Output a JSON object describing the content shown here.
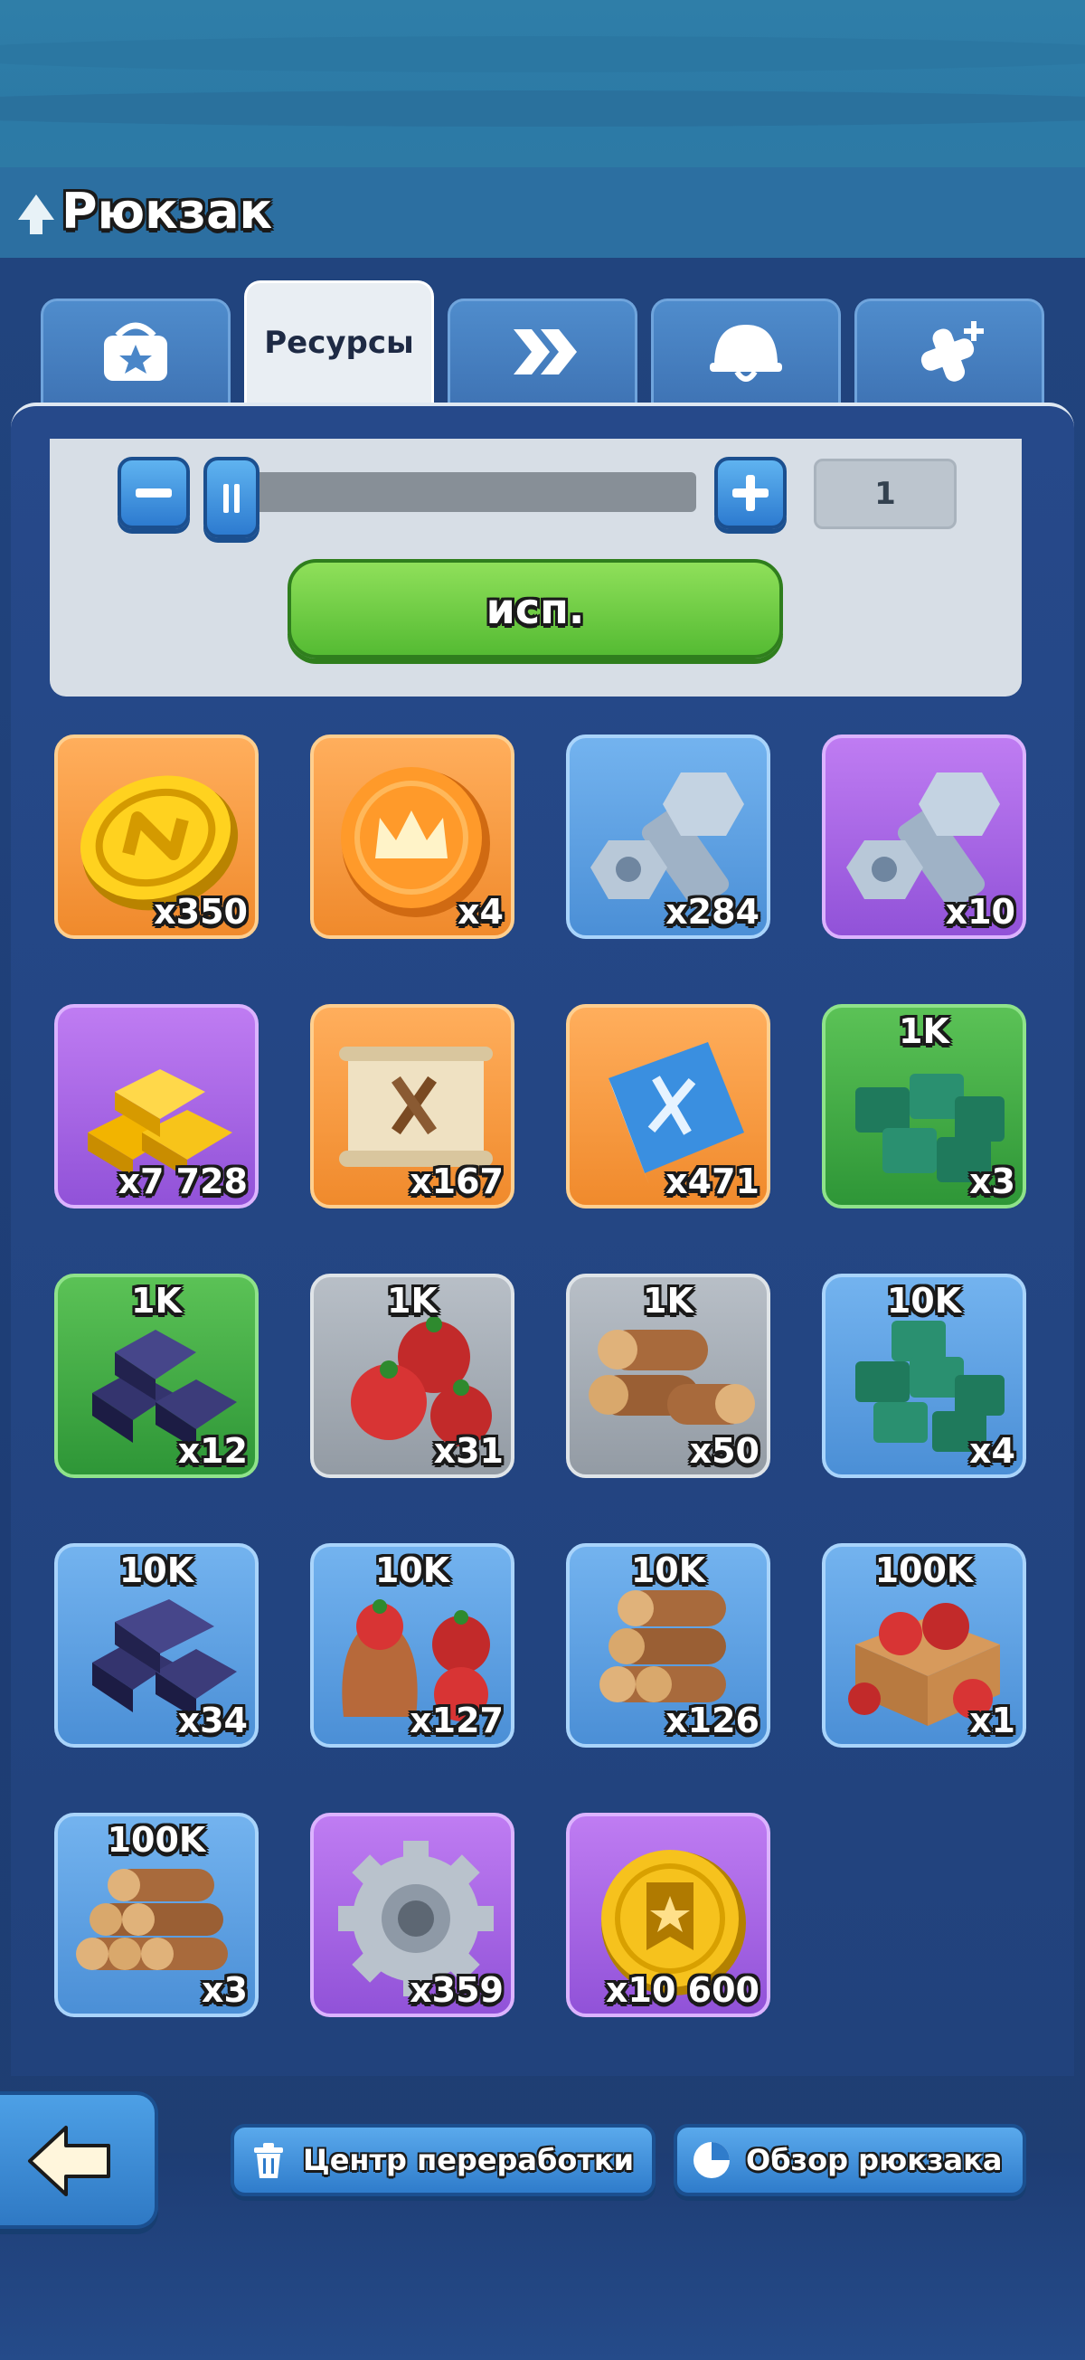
{
  "header": {
    "title": "Рюкзак"
  },
  "tabs": [
    {
      "id": "backpack",
      "icon": "bag-star-icon"
    },
    {
      "id": "resources",
      "label": "Ресурсы",
      "active": true
    },
    {
      "id": "speedups",
      "icon": "double-chevron-icon"
    },
    {
      "id": "equipment",
      "icon": "helmet-icon"
    },
    {
      "id": "boosts",
      "icon": "bandage-plus-icon"
    }
  ],
  "use_panel": {
    "quantity": "1",
    "use_label": "исп."
  },
  "items": [
    {
      "icon": "alliance-coin-icon",
      "count": "x350",
      "tier": ""
    },
    {
      "icon": "crown-coin-icon",
      "count": "x4",
      "tier": ""
    },
    {
      "icon": "blue-bolt-nut-icon",
      "count": "x284",
      "tier": ""
    },
    {
      "icon": "purple-bolt-nut-icon",
      "count": "x10",
      "tier": ""
    },
    {
      "icon": "gold-bars-icon",
      "count": "x7 728",
      "tier": ""
    },
    {
      "icon": "blueprint-scroll-icon",
      "count": "x167",
      "tier": ""
    },
    {
      "icon": "skill-book-icon",
      "count": "x471",
      "tier": ""
    },
    {
      "icon": "supply-crates-icon",
      "count": "x3",
      "tier": "1K"
    },
    {
      "icon": "iron-ingots-icon",
      "count": "x12",
      "tier": "1K"
    },
    {
      "icon": "food-tomatoes-icon",
      "count": "x31",
      "tier": "1K"
    },
    {
      "icon": "wood-logs-icon",
      "count": "x50",
      "tier": "1K"
    },
    {
      "icon": "supply-crates-icon",
      "count": "x4",
      "tier": "10K"
    },
    {
      "icon": "iron-ingots-icon",
      "count": "x34",
      "tier": "10K"
    },
    {
      "icon": "food-sack-icon",
      "count": "x127",
      "tier": "10K"
    },
    {
      "icon": "wood-logs-icon",
      "count": "x126",
      "tier": "10K"
    },
    {
      "icon": "food-box-icon",
      "count": "x1",
      "tier": "100K"
    },
    {
      "icon": "wood-logs-icon",
      "count": "x3",
      "tier": "100K"
    },
    {
      "icon": "gear-icon",
      "count": "x359",
      "tier": ""
    },
    {
      "icon": "medal-coin-icon",
      "count": "x10 600",
      "tier": ""
    }
  ],
  "bottom": {
    "recycle_label": "Центр переработки",
    "overview_label": "Обзор рюкзака"
  }
}
